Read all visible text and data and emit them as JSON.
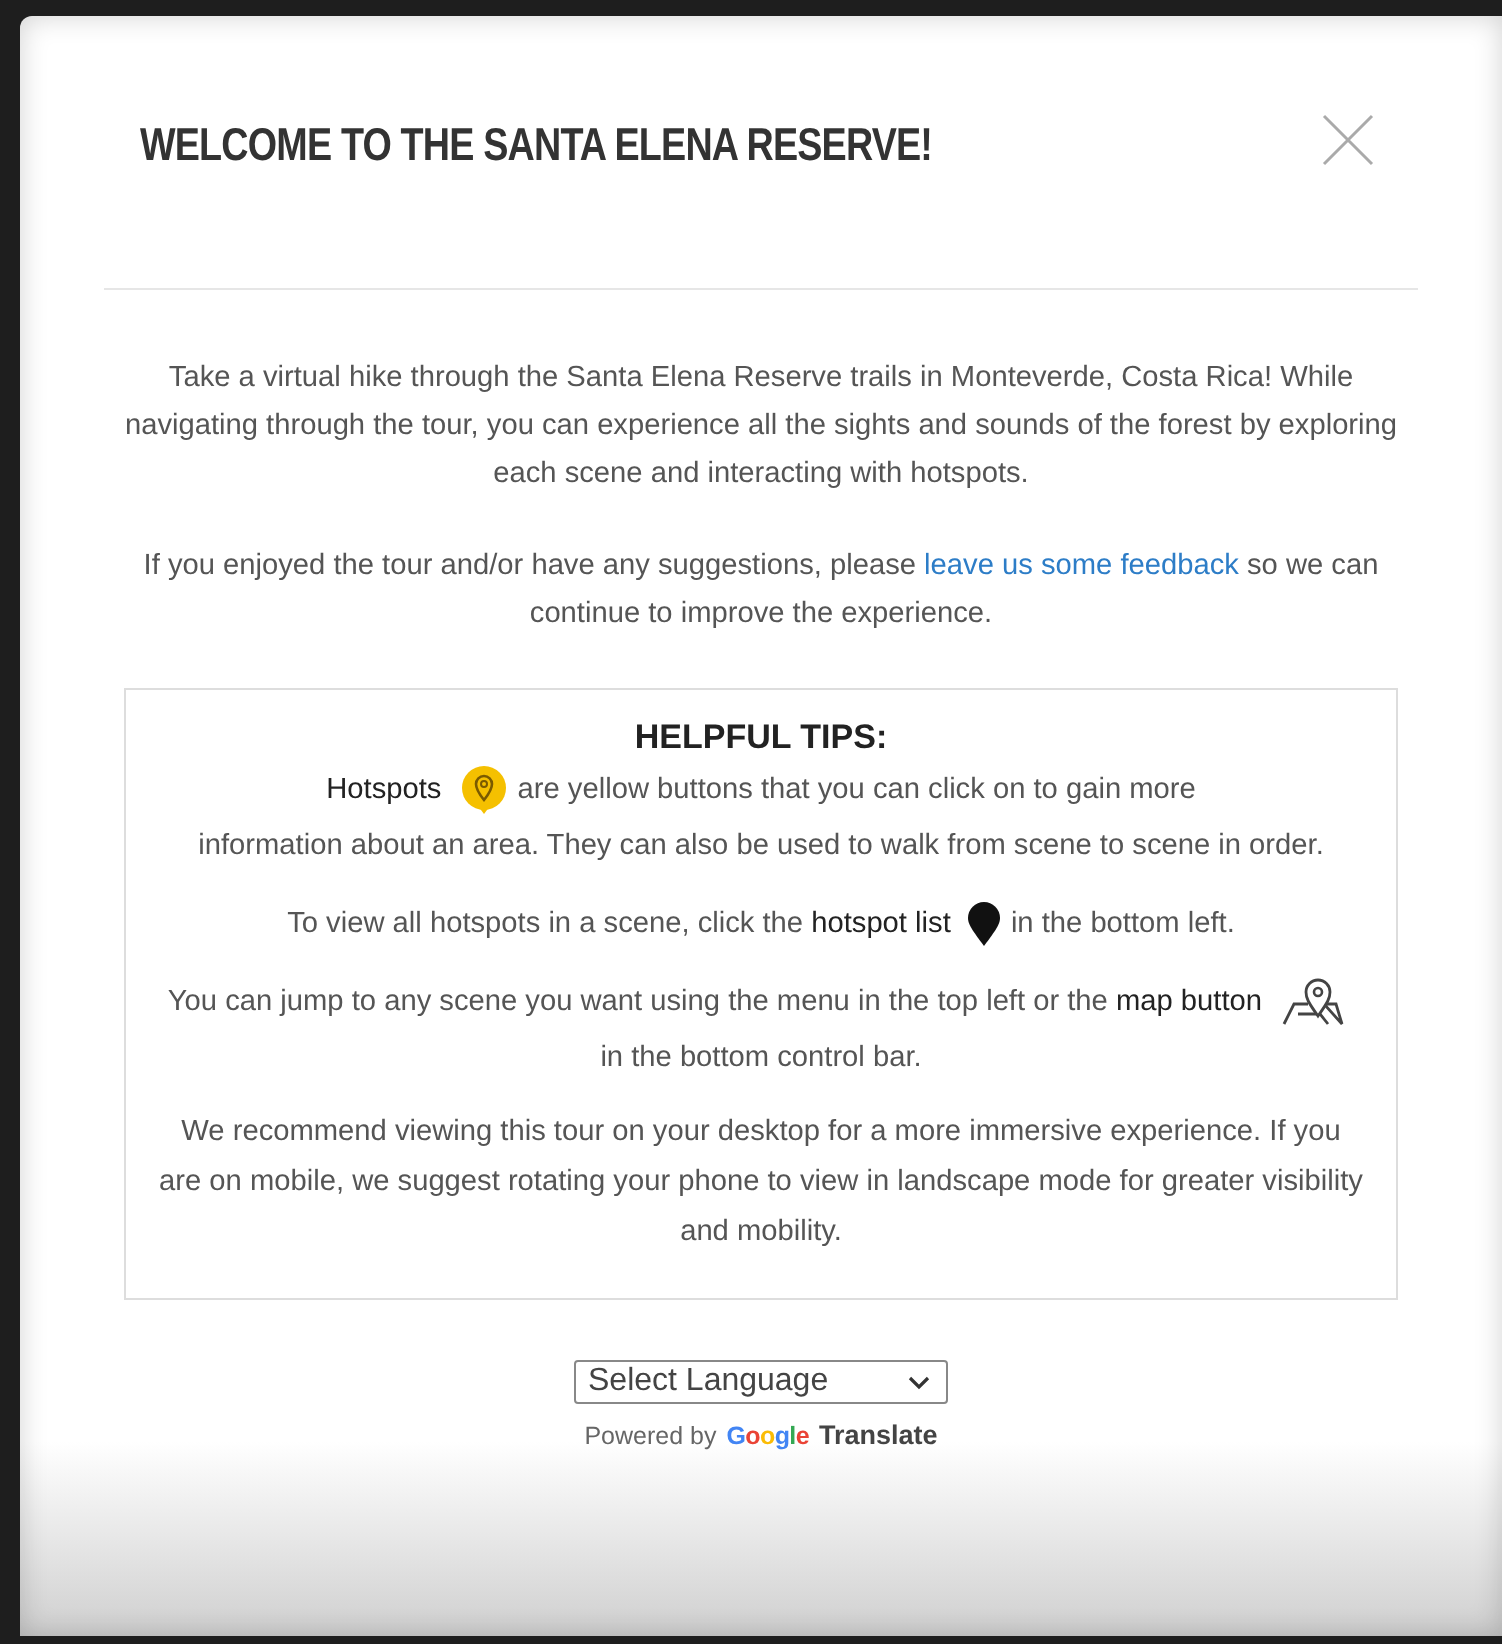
{
  "modal": {
    "title": "WELCOME TO THE SANTA ELENA RESERVE!",
    "intro": "Take a virtual hike through the Santa Elena Reserve trails in Monteverde, Costa Rica! While navigating through the tour, you can experience all the sights and sounds of the forest by exploring each scene and interacting with hotspots.",
    "feedback": {
      "before": "If you enjoyed the tour and/or have any suggestions, please ",
      "link": "leave us some feedback",
      "after": " so we can continue to improve the experience."
    },
    "tips": {
      "heading": "HELPFUL TIPS:",
      "paragraphs": [
        {
          "parts": [
            {
              "kind": "bold",
              "text": "Hotspots"
            },
            {
              "kind": "hotspot_icon"
            },
            {
              "kind": "text",
              "text": "are yellow buttons that you can click on to gain more"
            },
            {
              "kind": "text",
              "text": "information about an area. They can also be used to walk from scene to"
            },
            {
              "kind": "text",
              "text": "scene in order."
            }
          ]
        },
        {
          "parts": [
            {
              "kind": "text",
              "text": "To view all hotspots in a scene, click the"
            },
            {
              "kind": "bold",
              "text": "hotspot list"
            },
            {
              "kind": "pin_icon"
            },
            {
              "kind": "text",
              "text": "in the bottom left."
            }
          ]
        },
        {
          "parts": [
            {
              "kind": "text",
              "text": "You can jump to any scene you want using the menu in the top left or the"
            },
            {
              "kind": "bold",
              "text": "map button"
            },
            {
              "kind": "map_icon"
            },
            {
              "kind": "text",
              "text": "in the bottom control bar."
            }
          ]
        },
        {
          "parts": [
            {
              "kind": "text",
              "text": "We recommend viewing this tour on your desktop for a more immersive experience. If you are on mobile, we suggest rotating your phone to view in landscape mode for greater visibility and mobility."
            }
          ]
        }
      ]
    },
    "language_select": {
      "value": "Select Language"
    },
    "powered_by": {
      "text": "Powered by",
      "brand": "Google",
      "product": "Translate"
    }
  }
}
